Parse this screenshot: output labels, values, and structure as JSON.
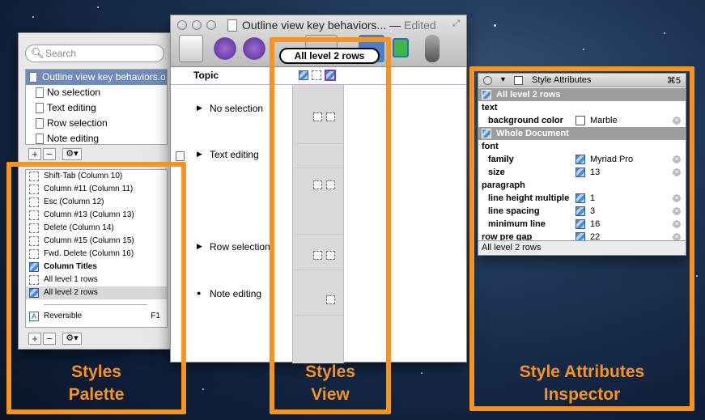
{
  "palette": {
    "search_placeholder": "Search",
    "documents": [
      {
        "label": "Outline view key behaviors.o",
        "selected": true
      },
      {
        "label": "No selection",
        "selected": false
      },
      {
        "label": "Text editing",
        "selected": false
      },
      {
        "label": "Row selection",
        "selected": false
      },
      {
        "label": "Note editing",
        "selected": false
      }
    ],
    "add_label": "+",
    "remove_label": "−",
    "gear_label": "⚙▾",
    "styles": [
      {
        "label": "Shift-Tab (Column 10)",
        "icon": "dashed-square"
      },
      {
        "label": "Column #11 (Column 11)",
        "icon": "dashed-square"
      },
      {
        "label": "Esc (Column 12)",
        "icon": "dashed-square"
      },
      {
        "label": "Column #13 (Column 13)",
        "icon": "dashed-square"
      },
      {
        "label": "Delete (Column 14)",
        "icon": "dashed-square"
      },
      {
        "label": "Column #15 (Column 15)",
        "icon": "dashed-square"
      },
      {
        "label": "Fwd. Delete (Column 16)",
        "icon": "dashed-square"
      },
      {
        "label": "Column Titles",
        "icon": "blue-style-square",
        "bold": true
      },
      {
        "label": "All level 1 rows",
        "icon": "dashed-square"
      },
      {
        "label": "All level 2 rows",
        "icon": "blue-style-square",
        "highlighted": true
      }
    ],
    "named_style": {
      "label": "Reversible",
      "shortcut": "F1",
      "icon": "a-style-square"
    }
  },
  "outline_window": {
    "title": "Outline view key behaviors...",
    "edited": "Edited",
    "column_title": "Topic",
    "rows": [
      {
        "label": "No selection",
        "marker": "▶"
      },
      {
        "label": "Text editing",
        "marker": "▶"
      },
      {
        "label": "Row selection",
        "marker": "▶"
      },
      {
        "label": "Note editing",
        "marker": "●"
      }
    ],
    "bubble": "All level 2 rows"
  },
  "inspector": {
    "title": "Style Attributes",
    "shortcut": "⌘5",
    "header1": "All level 2 rows",
    "section_text": "text",
    "attr_bg_name": "background color",
    "attr_bg_value": "Marble",
    "header2": "Whole Document",
    "section_font": "font",
    "attr_family_name": "family",
    "attr_family_value": "Myriad Pro",
    "attr_size_name": "size",
    "attr_size_value": "13",
    "section_paragraph": "paragraph",
    "attr_lh_name": "line height multiple",
    "attr_lh_value": "1",
    "attr_ls_name": "line spacing",
    "attr_ls_value": "3",
    "attr_ml_name": "minimum line",
    "attr_ml_value": "16",
    "attr_rpg_name": "row pre gap",
    "attr_rpg_value": "22",
    "status": "All level 2 rows",
    "remove_glyph": "×"
  },
  "callouts": {
    "palette_line1": "Styles",
    "palette_line2": "Palette",
    "view_line1": "Styles",
    "view_line2": "View",
    "inspector_line1": "Style Attributes",
    "inspector_line2": "Inspector"
  },
  "colors": {
    "accent_orange": "#f7931e",
    "selection_blue": "#6f8cb8",
    "style_blue": "#4c8ad8"
  }
}
